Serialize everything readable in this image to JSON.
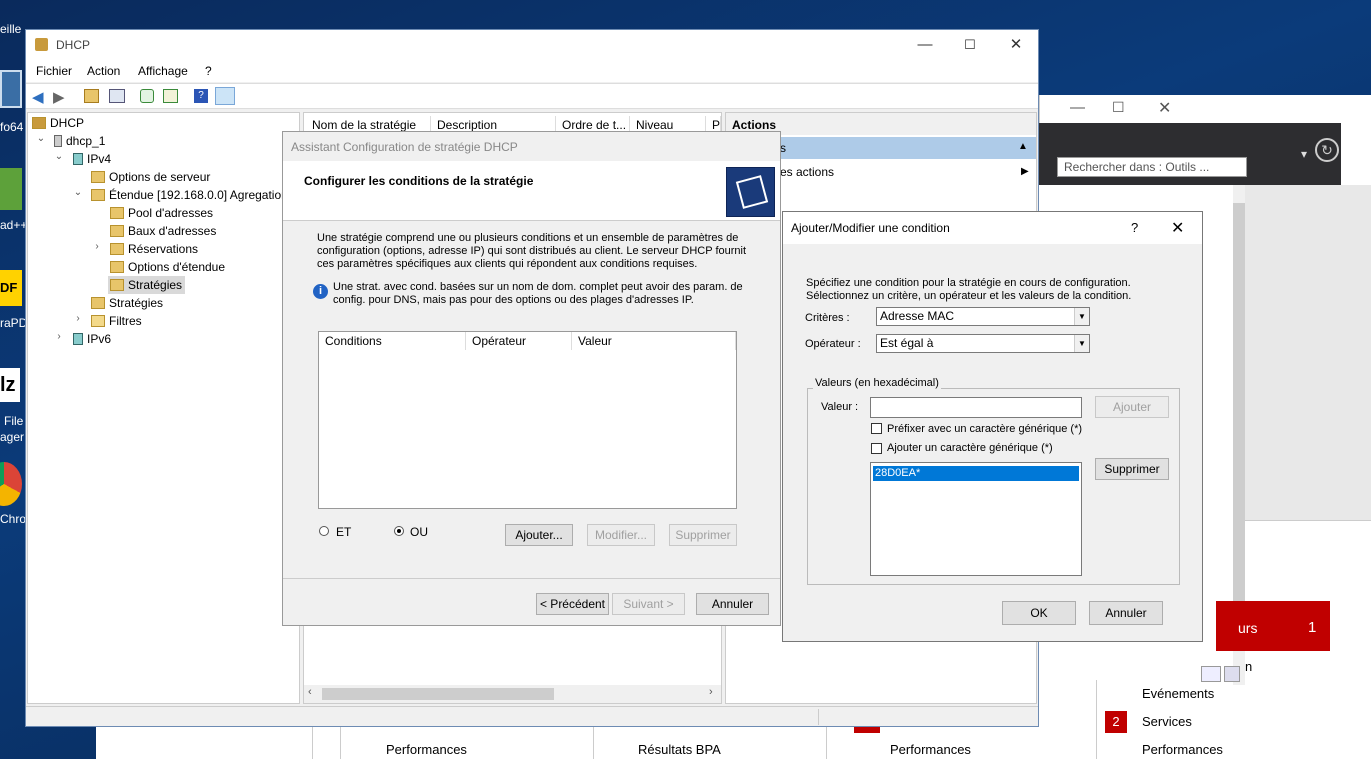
{
  "desktop": {
    "icons": [
      "eille",
      "fo64",
      "ad++",
      "raPD",
      "File",
      "ager",
      "Chro"
    ],
    "pdf_logo": "DF",
    "fz_logo": "lz"
  },
  "server_manager": {
    "search_placeholder": "Rechercher dans : Outils ...",
    "tiles": [
      "Performances",
      "Résultats BPA",
      "Performances"
    ],
    "side_items": [
      {
        "badge": "",
        "label": "n"
      },
      {
        "badge": "",
        "label": "Evénements"
      },
      {
        "badge": "2",
        "label": "Services"
      },
      {
        "badge": "",
        "label": "Performances"
      }
    ],
    "red_tile": {
      "label": "urs",
      "count": "1"
    }
  },
  "dhcp": {
    "title": "DHCP",
    "menu": [
      "Fichier",
      "Action",
      "Affichage",
      "?"
    ],
    "tree": [
      {
        "label": "DHCP"
      },
      {
        "label": "dhcp_1"
      },
      {
        "label": "IPv4"
      },
      {
        "label": "Options de serveur"
      },
      {
        "label": "Étendue [192.168.0.0] Agregation"
      },
      {
        "label": "Pool d'adresses"
      },
      {
        "label": "Baux d'adresses"
      },
      {
        "label": "Réservations"
      },
      {
        "label": "Options d'étendue"
      },
      {
        "label": "Stratégies"
      },
      {
        "label": "Stratégies"
      },
      {
        "label": "Filtres"
      },
      {
        "label": "IPv6"
      }
    ],
    "columns": [
      "Nom de la stratégie",
      "Description",
      "Ordre de t...",
      "Niveau",
      "P"
    ],
    "actions": {
      "header": "Actions",
      "group": "s",
      "more": "es actions"
    }
  },
  "wizard": {
    "window_title": "Assistant Configuration de stratégie DHCP",
    "heading": "Configurer les conditions de la stratégie",
    "intro": "Une stratégie comprend une ou plusieurs conditions et un ensemble de paramètres de configuration (options, adresse IP) qui sont distribués au client. Le serveur DHCP fournit ces paramètres spécifiques aux clients qui répondent aux conditions requises.",
    "info": "Une strat. avec cond. basées sur un nom de dom. complet peut avoir des param. de config. pour DNS, mais pas pour des options ou des plages d'adresses IP.",
    "columns": [
      "Conditions",
      "Opérateur",
      "Valeur"
    ],
    "radio_et": "ET",
    "radio_ou": "OU",
    "add": "Ajouter...",
    "modify": "Modifier...",
    "delete": "Supprimer",
    "back": "< Précédent",
    "next": "Suivant >",
    "cancel": "Annuler"
  },
  "dialog": {
    "title": "Ajouter/Modifier une condition",
    "help": "?",
    "desc": "Spécifiez une condition pour la stratégie en cours de configuration. Sélectionnez un critère, un opérateur et les valeurs de la condition.",
    "criteria_label": "Critères :",
    "criteria_value": "Adresse MAC",
    "operator_label": "Opérateur :",
    "operator_value": "Est égal à",
    "group_label": "Valeurs (en hexadécimal)",
    "value_label": "Valeur :",
    "value_input": "",
    "add": "Ajouter",
    "prefix_cb": "Préfixer avec un caractère générique (*)",
    "suffix_cb": "Ajouter un caractère générique (*)",
    "values": [
      "28D0EA*"
    ],
    "remove": "Supprimer",
    "ok": "OK",
    "cancel": "Annuler"
  }
}
